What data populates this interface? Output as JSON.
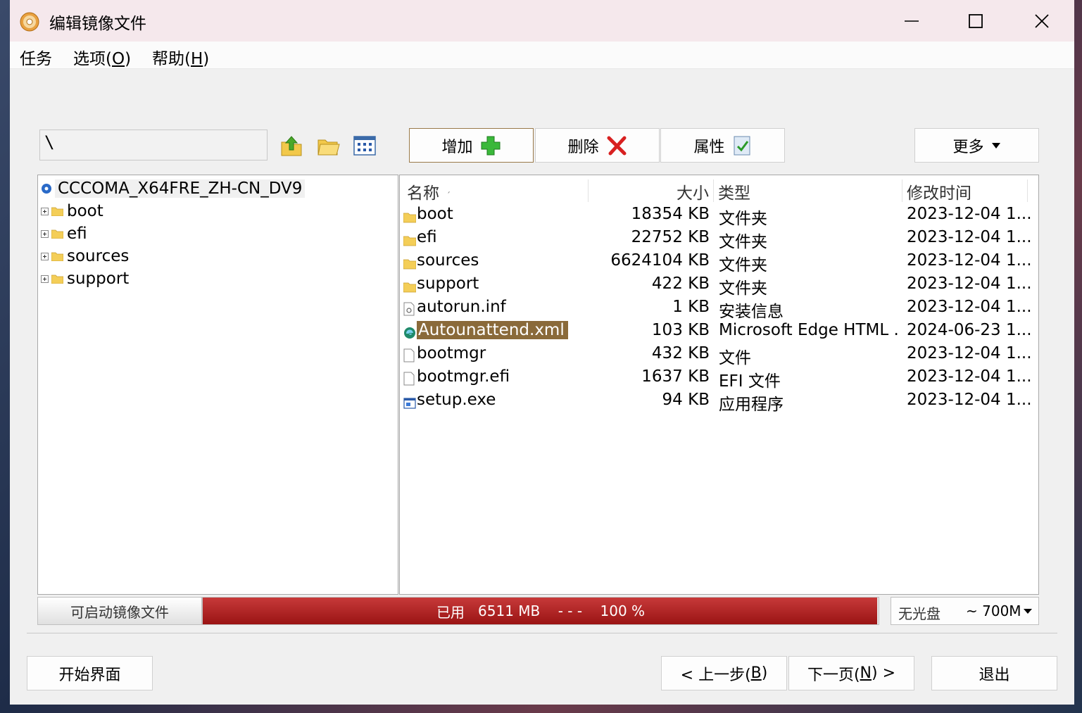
{
  "window": {
    "title": "编辑镜像文件",
    "controls": {
      "minimize": "minimize-icon",
      "maximize": "maximize-icon",
      "close": "close-icon"
    }
  },
  "menu": {
    "task": {
      "label": "任务"
    },
    "options": {
      "label": "选项(",
      "key": "O",
      "suffix": ")"
    },
    "help": {
      "label": "帮助(",
      "key": "H",
      "suffix": ")"
    }
  },
  "path": {
    "value": "\\"
  },
  "toolbar": {
    "add_label": "增加",
    "delete_label": "删除",
    "props_label": "属性",
    "more_label": "更多"
  },
  "tree": {
    "root": "CCCOMA_X64FRE_ZH-CN_DV9",
    "items": [
      {
        "label": "boot"
      },
      {
        "label": "efi"
      },
      {
        "label": "sources"
      },
      {
        "label": "support"
      }
    ]
  },
  "list": {
    "headers": {
      "name": "名称",
      "size": "大小",
      "type": "类型",
      "date": "修改时间"
    },
    "rows": [
      {
        "icon": "folder-icon",
        "name": "boot",
        "size": "18354 KB",
        "type": "文件夹",
        "date": "2023-12-04 1..."
      },
      {
        "icon": "folder-icon",
        "name": "efi",
        "size": "22752 KB",
        "type": "文件夹",
        "date": "2023-12-04 1..."
      },
      {
        "icon": "folder-icon",
        "name": "sources",
        "size": "6624104 KB",
        "type": "文件夹",
        "date": "2023-12-04 1..."
      },
      {
        "icon": "folder-icon",
        "name": "support",
        "size": "422 KB",
        "type": "文件夹",
        "date": "2023-12-04 1..."
      },
      {
        "icon": "settings-file-icon",
        "name": "autorun.inf",
        "size": "1 KB",
        "type": "安装信息",
        "date": "2023-12-04 1..."
      },
      {
        "icon": "edge-icon",
        "name": "Autounattend.xml",
        "size": "103 KB",
        "type": "Microsoft Edge HTML ...",
        "date": "2024-06-23 1...",
        "selected": true
      },
      {
        "icon": "file-icon",
        "name": "bootmgr",
        "size": "432 KB",
        "type": "文件",
        "date": "2023-12-04 1..."
      },
      {
        "icon": "file-icon",
        "name": "bootmgr.efi",
        "size": "1637 KB",
        "type": "EFI 文件",
        "date": "2023-12-04 1..."
      },
      {
        "icon": "exe-icon",
        "name": "setup.exe",
        "size": "94 KB",
        "type": "应用程序",
        "date": "2023-12-04 1..."
      }
    ]
  },
  "status": {
    "label": "可启动镜像文件",
    "used_label": "已用",
    "used_value": "6511 MB",
    "separator": "- - -",
    "percent": "100 %",
    "fill_fraction": 0.998,
    "disc_label": "无光盘",
    "disc_size": "~ 700M"
  },
  "nav": {
    "start_label": "开始界面",
    "prev_prefix": "< 上一步(",
    "prev_key": "B",
    "prev_suffix": ")",
    "next_prefix": "下一页(",
    "next_key": "N",
    "next_suffix": ") >",
    "exit_label": "退出"
  },
  "colors": {
    "accent_fill": "#9a1414",
    "selection": "#8a6a3a",
    "titlebar": "#f5e8ec"
  }
}
